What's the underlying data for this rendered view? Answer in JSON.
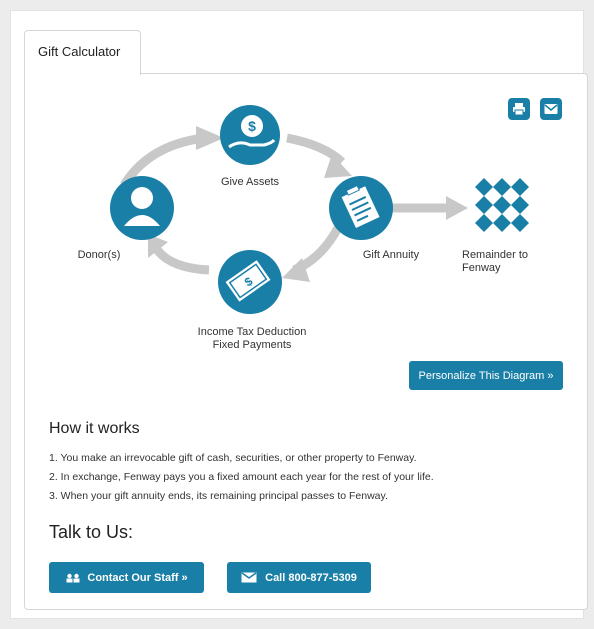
{
  "tab": {
    "label": "Gift Calculator"
  },
  "diagram": {
    "give_assets": "Give Assets",
    "donors": "Donor(s)",
    "gift_annuity": "Gift Annuity",
    "remainder_line1": "Remainder to",
    "remainder_line2": "Fenway",
    "deduction_line1": "Income Tax Deduction",
    "deduction_line2": "Fixed Payments",
    "personalize_button": "Personalize This Diagram »"
  },
  "how_it_works": {
    "title": "How it works",
    "steps": [
      "1. You make an irrevocable gift of cash, securities, or other property to Fenway.",
      "2. In exchange, Fenway pays you a fixed amount each year for the rest of your life.",
      "3. When your gift annuity ends, its remaining principal passes to Fenway."
    ]
  },
  "talk": {
    "title": "Talk to Us:",
    "contact_button": "Contact Our Staff »",
    "call_button": "Call 800-877-5309"
  },
  "colors": {
    "accent": "#1a7fa6",
    "arrow": "#c8c8c8"
  },
  "icons": [
    "print-icon",
    "email-icon",
    "dollar-hand-icon",
    "person-icon",
    "document-icon",
    "money-icon",
    "diamond-grid-icon",
    "people-icon",
    "envelope-icon"
  ]
}
